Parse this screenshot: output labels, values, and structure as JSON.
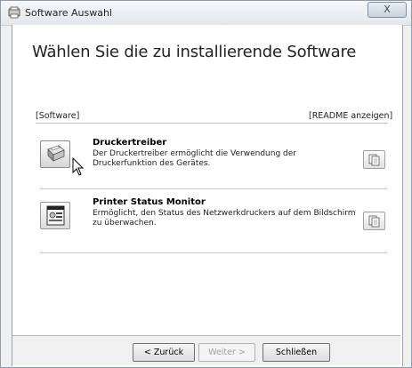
{
  "window": {
    "title": "Software Auswahl",
    "close_glyph": "X"
  },
  "page": {
    "heading": "Wählen Sie die zu installierende Software",
    "software_label": "[Software]",
    "readme_label": "[README anzeigen]"
  },
  "items": [
    {
      "title": "Druckertreiber",
      "description": "Der Druckertreiber ermöglicht die Verwendung der Druckerfunktion des Gerätes.",
      "icon": "printer-icon"
    },
    {
      "title": "Printer Status Monitor",
      "description": "Ermöglicht, den Status des Netzwerkdruckers auf dem Bildschirm zu überwachen.",
      "icon": "status-monitor-icon"
    }
  ],
  "buttons": {
    "back": "< Zurück",
    "next": "Weiter >",
    "close": "Schließen"
  },
  "colors": {
    "window_frame": "#8e9aa8",
    "content_bg": "#ffffff",
    "footer_bg": "#f0f0f0"
  }
}
